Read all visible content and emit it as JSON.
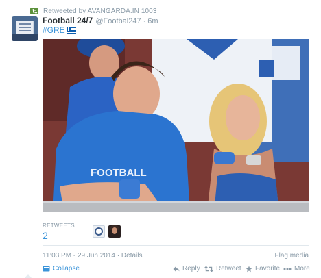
{
  "retweeted_by": "Retweeted by AVANGARDA.IN 1003",
  "tweet": {
    "fullname": "Football 24/7",
    "username": "@Footbal247",
    "separator": "·",
    "time": "6m",
    "hashtag": "#GRE"
  },
  "stats": {
    "label": "RETWEETS",
    "count": "2"
  },
  "meta": {
    "timestamp": "11:03 PM - 29 Jun 2014",
    "separator": "·",
    "details": "Details",
    "flag_media": "Flag media"
  },
  "actions": {
    "collapse": "Collapse",
    "reply": "Reply",
    "retweet": "Retweet",
    "favorite": "Favorite",
    "more": "More"
  },
  "colors": {
    "link": "#3b94d9",
    "muted": "#8899a6",
    "retweet_green": "#5c913b",
    "divider": "#e1e8ed"
  },
  "icons": {
    "retweet_header": "retweet-icon",
    "flag": "greece-flag-icon",
    "collapse": "collapse-icon",
    "reply": "reply-icon",
    "retweet": "retweet-icon",
    "favorite": "star-icon",
    "more": "ellipsis-icon"
  }
}
